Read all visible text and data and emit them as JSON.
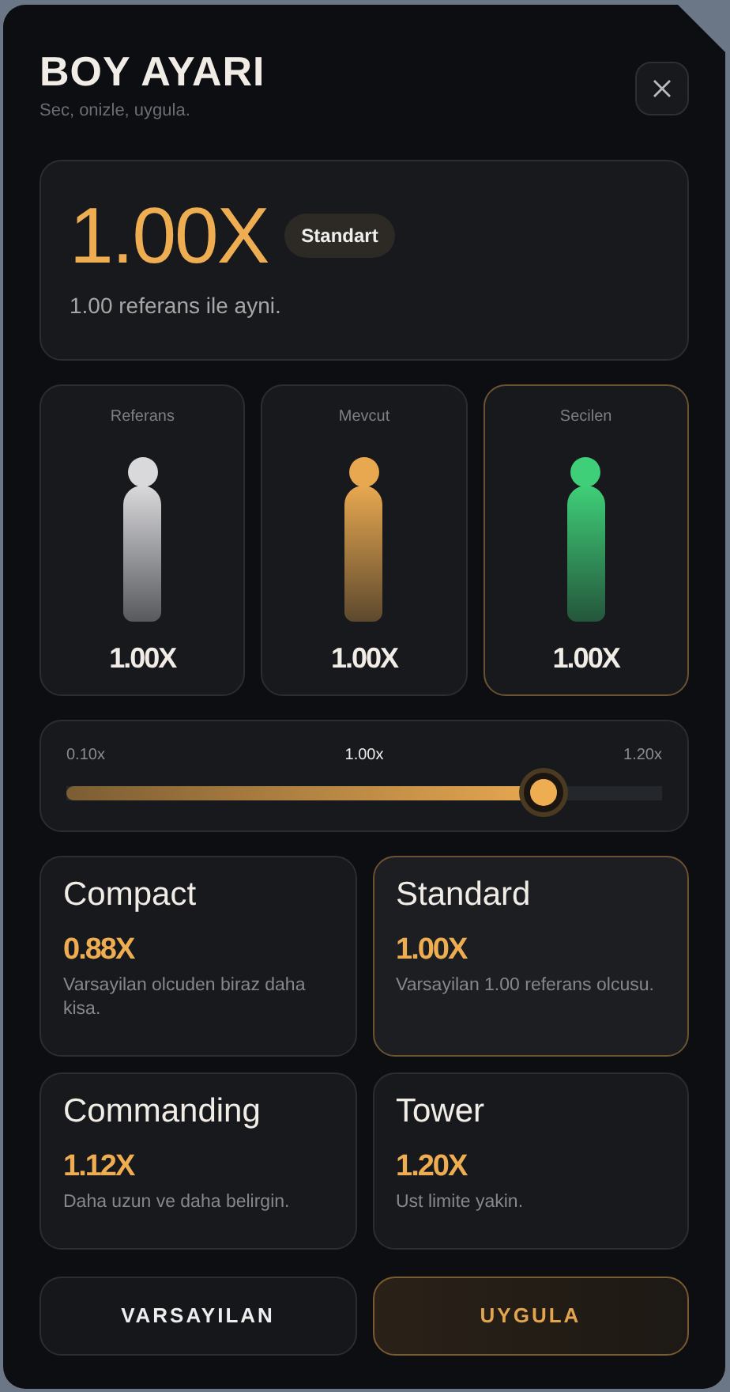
{
  "header": {
    "title": "BOY AYARI",
    "subtitle": "Sec, onizle, uygula."
  },
  "hero": {
    "value": "1.00X",
    "badge": "Standart",
    "note": "1.00 referans ile ayni."
  },
  "previews": [
    {
      "label": "Referans",
      "value": "1.00X",
      "color": "#d9d9dc",
      "selected": false
    },
    {
      "label": "Mevcut",
      "value": "1.00X",
      "color": "#e8a850",
      "selected": false
    },
    {
      "label": "Secilen",
      "value": "1.00X",
      "color": "#3fcf78",
      "selected": true
    }
  ],
  "slider": {
    "min_label": "0.10x",
    "value_label": "1.00x",
    "max_label": "1.20x",
    "level": 0.8
  },
  "presets": [
    {
      "name": "Compact",
      "value": "0.88X",
      "description": "Varsayilan olcuden biraz daha kisa.",
      "selected": false
    },
    {
      "name": "Standard",
      "value": "1.00X",
      "description": "Varsayilan 1.00 referans olcusu.",
      "selected": true
    },
    {
      "name": "Commanding",
      "value": "1.12X",
      "description": "Daha uzun ve daha belirgin.",
      "selected": false
    },
    {
      "name": "Tower",
      "value": "1.20X",
      "description": "Ust limite yakin.",
      "selected": false
    }
  ],
  "buttons": [
    {
      "label": "VARSAYILAN",
      "kind": "secondary"
    },
    {
      "label": "UYGULA",
      "kind": "primary"
    }
  ]
}
